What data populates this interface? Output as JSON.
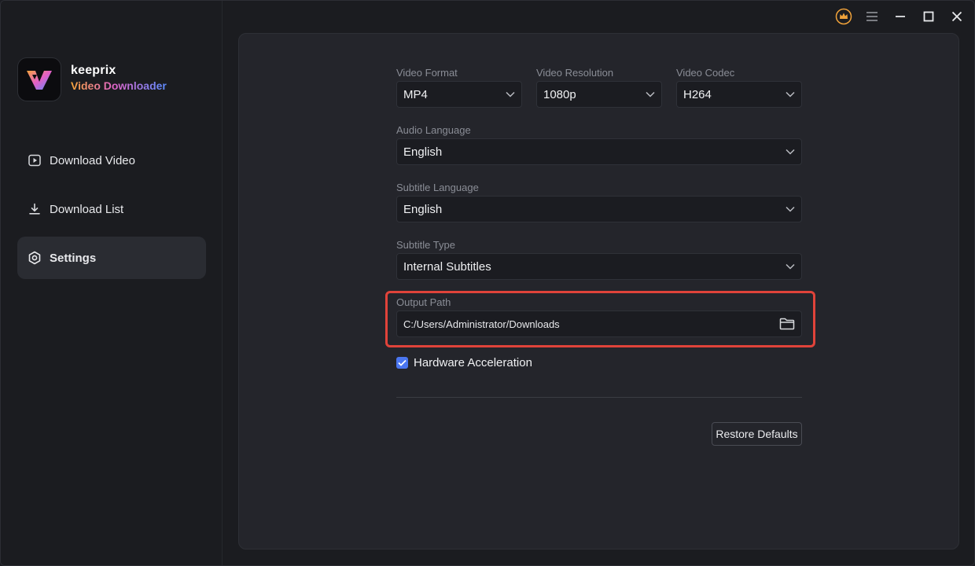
{
  "brand": {
    "name": "keeprix",
    "subtitle": "Video Downloader"
  },
  "sidebar": {
    "items": [
      {
        "label": "Download Video",
        "icon": "play-icon",
        "active": false
      },
      {
        "label": "Download List",
        "icon": "download-icon",
        "active": false
      },
      {
        "label": "Settings",
        "icon": "gear-icon",
        "active": true
      }
    ]
  },
  "titlebar": {
    "icons": [
      "crown-icon",
      "menu-icon",
      "minimize-icon",
      "maximize-icon",
      "close-icon"
    ]
  },
  "settings": {
    "video_format": {
      "label": "Video Format",
      "value": "MP4"
    },
    "video_resolution": {
      "label": "Video Resolution",
      "value": "1080p"
    },
    "video_codec": {
      "label": "Video Codec",
      "value": "H264"
    },
    "audio_language": {
      "label": "Audio Language",
      "value": "English"
    },
    "subtitle_language": {
      "label": "Subtitle Language",
      "value": "English"
    },
    "subtitle_type": {
      "label": "Subtitle Type",
      "value": "Internal Subtitles"
    },
    "output_path": {
      "label": "Output Path",
      "value": "C:/Users/Administrator/Downloads"
    },
    "hardware_acceleration": {
      "label": "Hardware Acceleration",
      "checked": true
    },
    "restore_defaults_label": "Restore Defaults"
  },
  "colors": {
    "accent": "#4a76f0",
    "highlight": "#e0433a",
    "crown": "#f0a23a"
  }
}
